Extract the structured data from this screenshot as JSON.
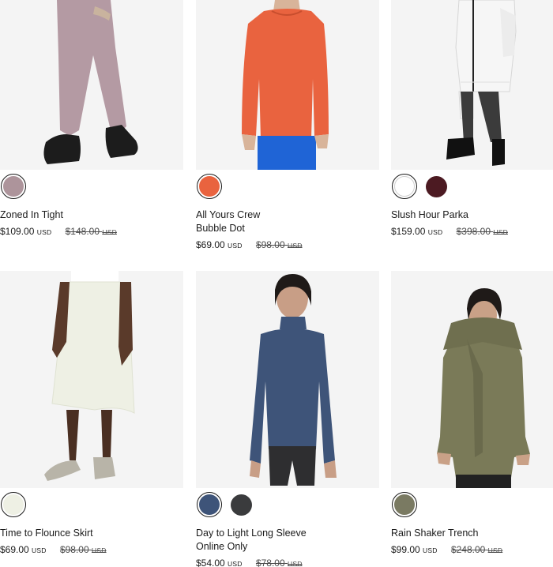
{
  "products": [
    {
      "name_lines": [
        "Zoned In Tight",
        ""
      ],
      "price": "$109.00",
      "currency": "USD",
      "original_price": "$148.00",
      "original_currency": "USD",
      "swatches": [
        {
          "color": "#ad949b",
          "selected": true
        }
      ],
      "image_icon": "leggings-photo"
    },
    {
      "name_lines": [
        "All Yours Crew",
        "Bubble Dot"
      ],
      "price": "$69.00",
      "currency": "USD",
      "original_price": "$98.00",
      "original_currency": "USD",
      "swatches": [
        {
          "color": "#e9633f",
          "selected": true
        }
      ],
      "image_icon": "sweatshirt-photo"
    },
    {
      "name_lines": [
        "Slush Hour Parka",
        ""
      ],
      "price": "$159.00",
      "currency": "USD",
      "original_price": "$398.00",
      "original_currency": "USD",
      "swatches": [
        {
          "color": "#ffffff",
          "selected": true
        },
        {
          "color": "#4c1a22",
          "selected": false
        }
      ],
      "image_icon": "parka-photo"
    },
    {
      "name_lines": [
        "Time to Flounce Skirt",
        ""
      ],
      "price": "$69.00",
      "currency": "USD",
      "original_price": "$98.00",
      "original_currency": "USD",
      "swatches": [
        {
          "color": "#eef0e4",
          "selected": true
        }
      ],
      "image_icon": "skirt-photo"
    },
    {
      "name_lines": [
        "Day to Light Long Sleeve",
        "Online Only"
      ],
      "price": "$54.00",
      "currency": "USD",
      "original_price": "$78.00",
      "original_currency": "USD",
      "swatches": [
        {
          "color": "#3e5479",
          "selected": true
        },
        {
          "color": "#3a3b3d",
          "selected": false
        }
      ],
      "image_icon": "long-sleeve-photo"
    },
    {
      "name_lines": [
        "Rain Shaker Trench",
        ""
      ],
      "price": "$99.00",
      "currency": "USD",
      "original_price": "$248.00",
      "original_currency": "USD",
      "swatches": [
        {
          "color": "#7a7a62",
          "selected": true
        }
      ],
      "image_icon": "trench-coat-photo"
    }
  ]
}
